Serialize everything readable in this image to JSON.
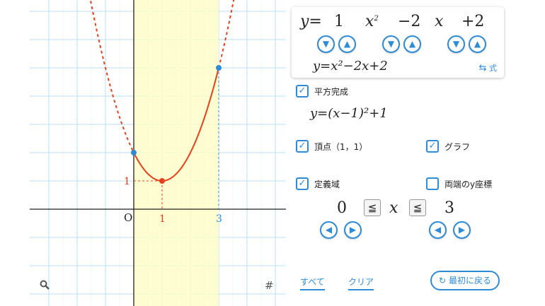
{
  "coef": {
    "y_eq": "y=",
    "a": "1",
    "x_sq": "x",
    "sq": "2",
    "b": "−2",
    "x": "x",
    "c": "+2"
  },
  "spinners": {
    "down": "▼",
    "up": "▲"
  },
  "formula": {
    "standard": "y=x²−2x+2",
    "toggle_label": "式",
    "vertex_form": "y=(x−1)²+1"
  },
  "checks": {
    "completing_square": "平方完成",
    "vertex": "頂点（1，1）",
    "graph": "グラフ",
    "domain": "定義域",
    "endpoint_y": "両端のy座標"
  },
  "checked_states": {
    "completing_square": true,
    "vertex": true,
    "graph": true,
    "domain": true,
    "endpoint_y": false
  },
  "domain_range": {
    "min": "0",
    "leq1": "≦",
    "var": "x",
    "leq2": "≦",
    "max": "3"
  },
  "arrows": {
    "left": "◀",
    "right": "▶"
  },
  "links": {
    "all": "すべて",
    "clear": "クリア",
    "reset": "最初に戻る"
  },
  "graph_labels": {
    "origin": "O",
    "x_one": "1",
    "x_three": "3",
    "y_one": "1"
  },
  "icons": {
    "search": "search-icon",
    "grid": "grid-icon"
  },
  "colors": {
    "curve": "#e8401c",
    "accent": "#2e8bd6",
    "domain_fill": "#fefbc9",
    "grid": "#b7dff0"
  },
  "chart_data": {
    "type": "line",
    "function": "y = x^2 - 2x + 2",
    "domain": [
      0,
      3
    ],
    "vertex": [
      1,
      1
    ],
    "points": [
      [
        0,
        2
      ],
      [
        1,
        1
      ],
      [
        3,
        5
      ]
    ],
    "grid": true
  }
}
